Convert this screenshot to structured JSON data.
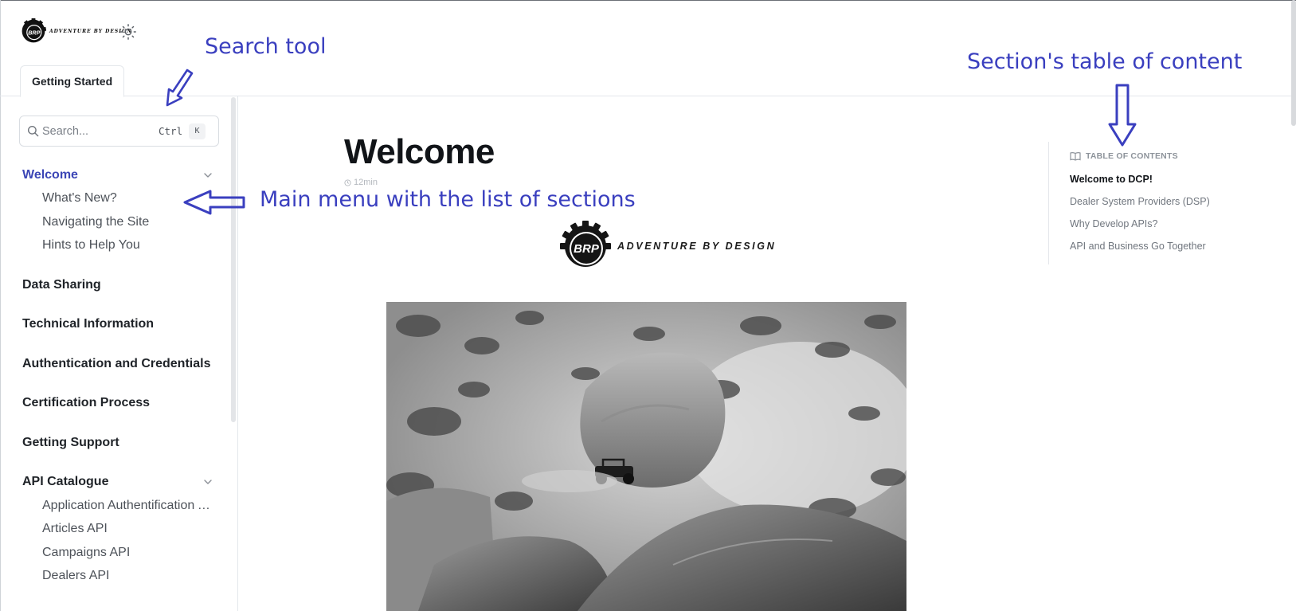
{
  "header": {
    "logo_tagline": "ADVENTURE BY DESIGN",
    "tab_label": "Getting Started"
  },
  "annotations": {
    "search_tool": "Search tool",
    "toc": "Section's table of content",
    "main_menu": "Main menu with the list of sections"
  },
  "search": {
    "placeholder": "Search...",
    "shortcut_modifier": "Ctrl",
    "shortcut_key": "K"
  },
  "sidebar": {
    "welcome": {
      "label": "Welcome",
      "children": [
        "What's New?",
        "Navigating the Site",
        "Hints to Help You"
      ]
    },
    "sections": [
      "Data Sharing",
      "Technical Information",
      "Authentication and Credentials",
      "Certification Process",
      "Getting Support"
    ],
    "api_catalogue": {
      "label": "API Catalogue",
      "children": [
        "Application Authentification API",
        "Articles API",
        "Campaigns API",
        "Dealers API"
      ]
    }
  },
  "content": {
    "title": "Welcome",
    "read_time": "12min",
    "brand_logo_text": "BRP",
    "brand_tagline": "ADVENTURE BY DESIGN"
  },
  "toc": {
    "heading": "TABLE OF CONTENTS",
    "items": [
      "Welcome to DCP!",
      "Dealer System Providers (DSP)",
      "Why Develop APIs?",
      "API and Business Go Together"
    ]
  },
  "colors": {
    "accent": "#3c46b6",
    "annotation": "#3a3fbf"
  }
}
